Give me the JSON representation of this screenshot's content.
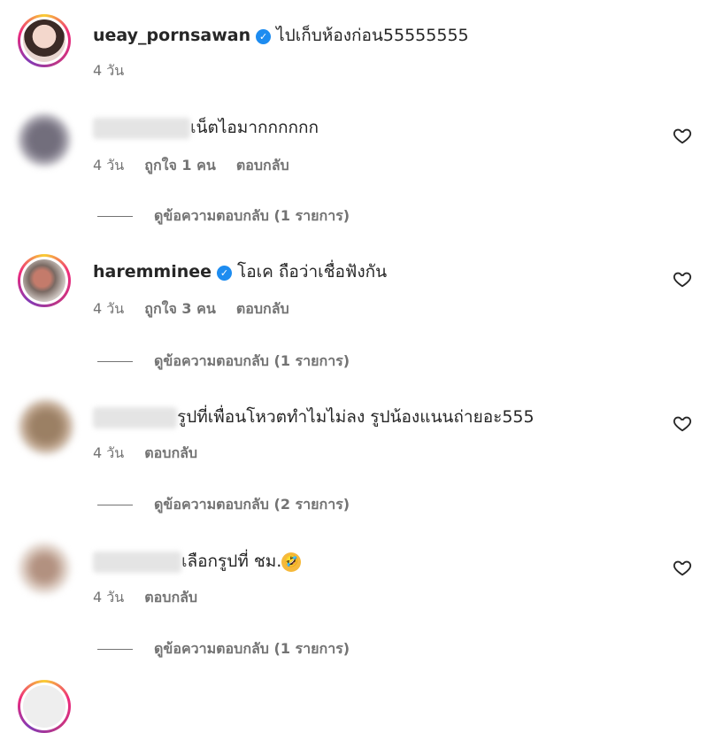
{
  "comments": [
    {
      "username": "ueay_pornsawan",
      "verified": true,
      "text": "ไปเก็บห้องก่อน55555555",
      "time": "4 วัน",
      "likes": "",
      "reply": ""
    },
    {
      "username": "",
      "verified": false,
      "text": "เน็ตไอมากกกกกก",
      "time": "4 วัน",
      "likes": "ถูกใจ 1 คน",
      "reply": "ตอบกลับ",
      "view_replies": "ดูข้อความตอบกลับ (1 รายการ)"
    },
    {
      "username": "haremminee",
      "verified": true,
      "text": "โอเค ถือว่าเชื่อฟังกัน",
      "time": "4 วัน",
      "likes": "ถูกใจ 3 คน",
      "reply": "ตอบกลับ",
      "view_replies": "ดูข้อความตอบกลับ (1 รายการ)"
    },
    {
      "username": "",
      "verified": false,
      "text": "รูปที่เพื่อนโหวตทำไมไม่ลง รูปน้องแนนถ่ายอะ555",
      "time": "4 วัน",
      "reply": "ตอบกลับ",
      "view_replies": "ดูข้อความตอบกลับ (2 รายการ)"
    },
    {
      "username": "",
      "verified": false,
      "text": "เลือกรูปที่ ชม.",
      "time": "4 วัน",
      "reply": "ตอบกลับ",
      "view_replies": "ดูข้อความตอบกลับ (1 รายการ)"
    }
  ],
  "icons": {
    "verified": "verified-badge-icon",
    "like": "heart-outline-icon",
    "emoji": "rolling-on-floor-laughing-emoji"
  },
  "colors": {
    "verified": "#1d8cf0",
    "meta_text": "#737373",
    "text": "#262626"
  }
}
